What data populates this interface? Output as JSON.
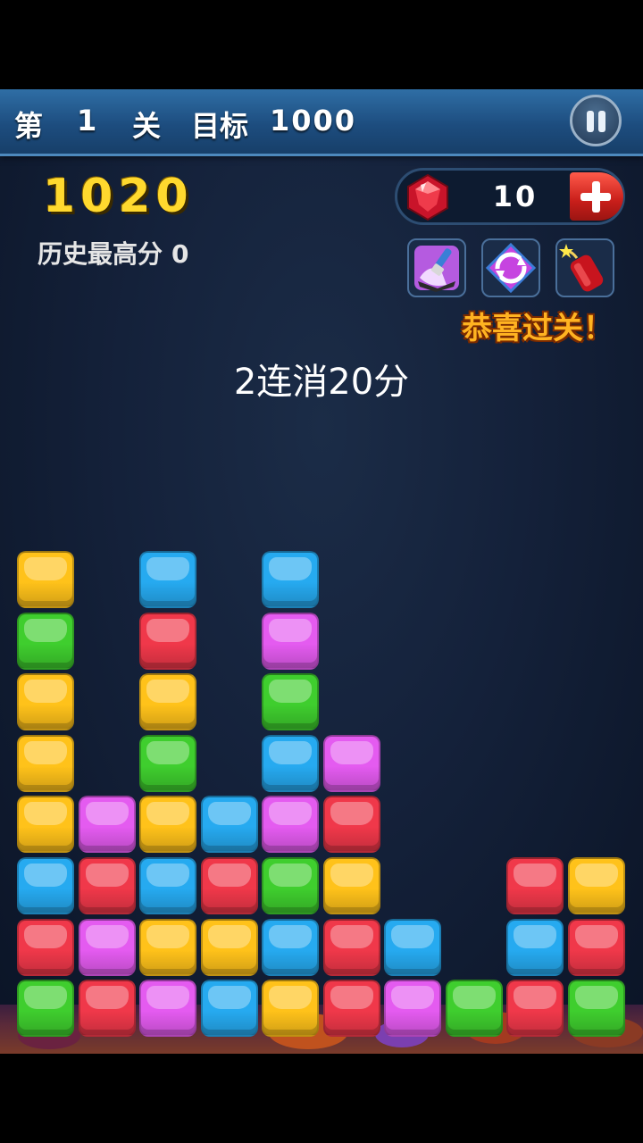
{
  "header": {
    "level_prefix": "第",
    "level_number": "1",
    "level_suffix": "关",
    "target_label": "目标",
    "target_value": "1000",
    "pause_icon": "pause-icon"
  },
  "score": "1020",
  "best_score": {
    "label": "历史最高分",
    "value": "0"
  },
  "gems": {
    "count": "10",
    "icon": "red-gem-icon",
    "add_icon": "plus-icon"
  },
  "tools": [
    {
      "name": "paint-brush-tool",
      "icon": "paint-brush-icon"
    },
    {
      "name": "refresh-tool",
      "icon": "refresh-icon"
    },
    {
      "name": "bomb-tool",
      "icon": "bomb-icon"
    }
  ],
  "congrats": "恭喜过关！",
  "combo_text": "2连消20分",
  "colors": {
    "yellow": "#ffc21a",
    "blue": "#26aaf0",
    "red": "#f0384a",
    "green": "#3fce2e",
    "pink": "#e45bf0"
  },
  "board": {
    "columns": 10,
    "rows": 8,
    "grid": [
      [
        "yellow",
        null,
        "blue",
        null,
        "blue",
        null,
        null,
        null,
        null,
        null
      ],
      [
        "green",
        null,
        "red",
        null,
        "pink",
        null,
        null,
        null,
        null,
        null
      ],
      [
        "yellow",
        null,
        "yellow",
        null,
        "green",
        null,
        null,
        null,
        null,
        null
      ],
      [
        "yellow",
        null,
        "green",
        null,
        "blue",
        "pink",
        null,
        null,
        null,
        null
      ],
      [
        "yellow",
        "pink",
        "yellow",
        "blue",
        "pink",
        "red",
        null,
        null,
        null,
        null
      ],
      [
        "blue",
        "red",
        "blue",
        "red",
        "green",
        "yellow",
        null,
        null,
        "red",
        "yellow"
      ],
      [
        "red",
        "pink",
        "yellow",
        "yellow",
        "blue",
        "red",
        "blue",
        null,
        "blue",
        "red"
      ],
      [
        "green",
        "red",
        "pink",
        "blue",
        "yellow",
        "red",
        "pink",
        "green",
        "red",
        "green"
      ]
    ]
  }
}
